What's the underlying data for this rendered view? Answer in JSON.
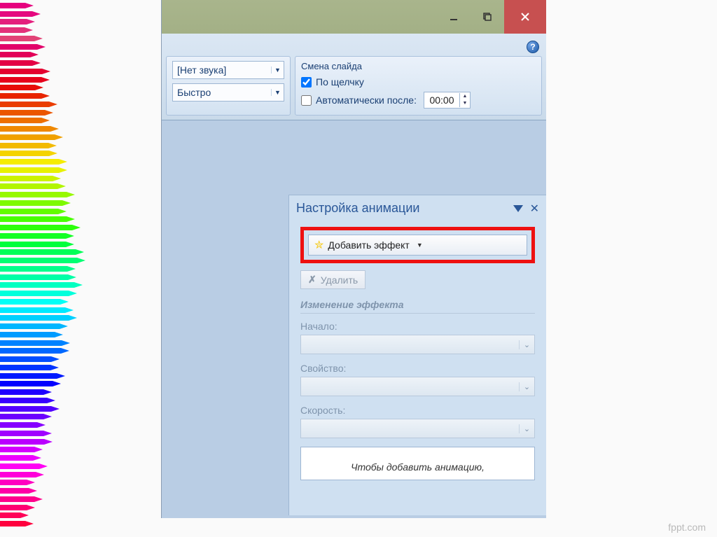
{
  "titlebar": {
    "minimize": "—",
    "maximize": "❐",
    "close": "✕"
  },
  "help": "?",
  "ribbon": {
    "sound_dd": "[Нет звука]",
    "speed_dd": "Быстро",
    "slide_change_group_title": "Смена слайда",
    "on_click_label": "По щелчку",
    "auto_after_label": "Автоматически после:",
    "auto_after_value": "00:00"
  },
  "panel": {
    "title": "Настройка анимации",
    "add_effect": "Добавить эффект",
    "delete": "Удалить",
    "section": "Изменение эффекта",
    "start_label": "Начало:",
    "property_label": "Свойство:",
    "speed_label": "Скорость:",
    "info": "Чтобы добавить анимацию,"
  },
  "watermark": "fppt.com",
  "pencil_colors": [
    "#e6007e",
    "#e5097f",
    "#e41f7d",
    "#e3317a",
    "#e24276",
    "#e2006a",
    "#e20058",
    "#e30044",
    "#e40030",
    "#e6001c",
    "#e70b08",
    "#e82400",
    "#ea3d00",
    "#eb5600",
    "#ed6f00",
    "#ef8800",
    "#f0a100",
    "#f2ba00",
    "#f4d300",
    "#f5ec00",
    "#e7f100",
    "#ccf300",
    "#b2f500",
    "#97f800",
    "#7dfa00",
    "#62fc00",
    "#48ff00",
    "#2dff0b",
    "#13ff24",
    "#00ff3d",
    "#00ff57",
    "#00ff72",
    "#00ff8c",
    "#00ffa7",
    "#00ffc1",
    "#00ffdb",
    "#00fff6",
    "#00eaff",
    "#00d0ff",
    "#00b6ff",
    "#009cff",
    "#0082ff",
    "#0068ff",
    "#004eff",
    "#0034ff",
    "#001aff",
    "#0400ff",
    "#1e00ff",
    "#3800ff",
    "#5200ff",
    "#6c00ff",
    "#8600ff",
    "#a000ff",
    "#ba00ff",
    "#d400ff",
    "#ee00ff",
    "#ff00f4",
    "#ff00da",
    "#ff00c0",
    "#ff00a6",
    "#ff008c",
    "#ff0072",
    "#ff0058",
    "#ff003e"
  ]
}
